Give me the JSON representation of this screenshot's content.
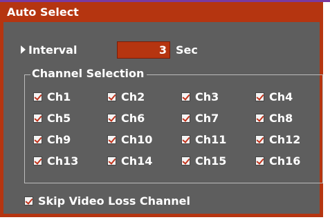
{
  "window": {
    "title": "Auto Select"
  },
  "interval": {
    "label": "Interval",
    "value": "3",
    "unit": "Sec"
  },
  "channel_selection": {
    "legend": "Channel Selection",
    "channels": [
      {
        "label": "Ch1",
        "checked": true
      },
      {
        "label": "Ch2",
        "checked": true
      },
      {
        "label": "Ch3",
        "checked": true
      },
      {
        "label": "Ch4",
        "checked": true
      },
      {
        "label": "Ch5",
        "checked": true
      },
      {
        "label": "Ch6",
        "checked": true
      },
      {
        "label": "Ch7",
        "checked": true
      },
      {
        "label": "Ch8",
        "checked": true
      },
      {
        "label": "Ch9",
        "checked": true
      },
      {
        "label": "Ch10",
        "checked": true
      },
      {
        "label": "Ch11",
        "checked": true
      },
      {
        "label": "Ch12",
        "checked": true
      },
      {
        "label": "Ch13",
        "checked": true
      },
      {
        "label": "Ch14",
        "checked": true
      },
      {
        "label": "Ch15",
        "checked": true
      },
      {
        "label": "Ch16",
        "checked": true
      }
    ]
  },
  "skip_video_loss": {
    "label": "Skip Video Loss Channel",
    "checked": true
  },
  "colors": {
    "accent": "#b53510",
    "panel_bg": "#5e5e5e",
    "text": "#ffffff",
    "check_mark": "#c0311a"
  },
  "icons": {
    "interval_marker": "triangle-right-icon",
    "checkbox": "checkbox-checked-icon"
  }
}
